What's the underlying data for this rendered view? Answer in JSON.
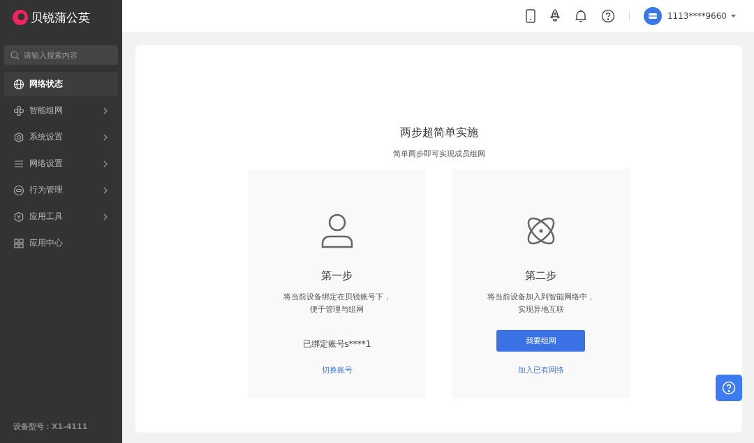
{
  "brand": {
    "name": "贝锐蒲公英"
  },
  "search": {
    "placeholder": "请输入搜索内容"
  },
  "menu": [
    {
      "label": "网络状态",
      "selected": true,
      "expandable": false
    },
    {
      "label": "智能组网",
      "selected": false,
      "expandable": true
    },
    {
      "label": "系统设置",
      "selected": false,
      "expandable": true
    },
    {
      "label": "网络设置",
      "selected": false,
      "expandable": true
    },
    {
      "label": "行为管理",
      "selected": false,
      "expandable": true
    },
    {
      "label": "应用工具",
      "selected": false,
      "expandable": true
    },
    {
      "label": "应用中心",
      "selected": false,
      "expandable": false
    }
  ],
  "device_model": "设备型号：X1-4111",
  "header": {
    "account": "1113****9660"
  },
  "main": {
    "title": "两步超简单实施",
    "subtitle": "简单两步即可实现成员组网",
    "steps": [
      {
        "kind": "bind",
        "title": "第一步",
        "description": [
          "将当前设备绑定在贝锐账号下，",
          "便于管理与组网"
        ],
        "status": "已绑定账号s****1",
        "link": "切换账号"
      },
      {
        "kind": "join",
        "title": "第二步",
        "description": [
          "将当前设备加入到智能网络中，",
          "实现异地互联"
        ],
        "button": "我要组网",
        "link": "加入已有网络"
      }
    ]
  }
}
